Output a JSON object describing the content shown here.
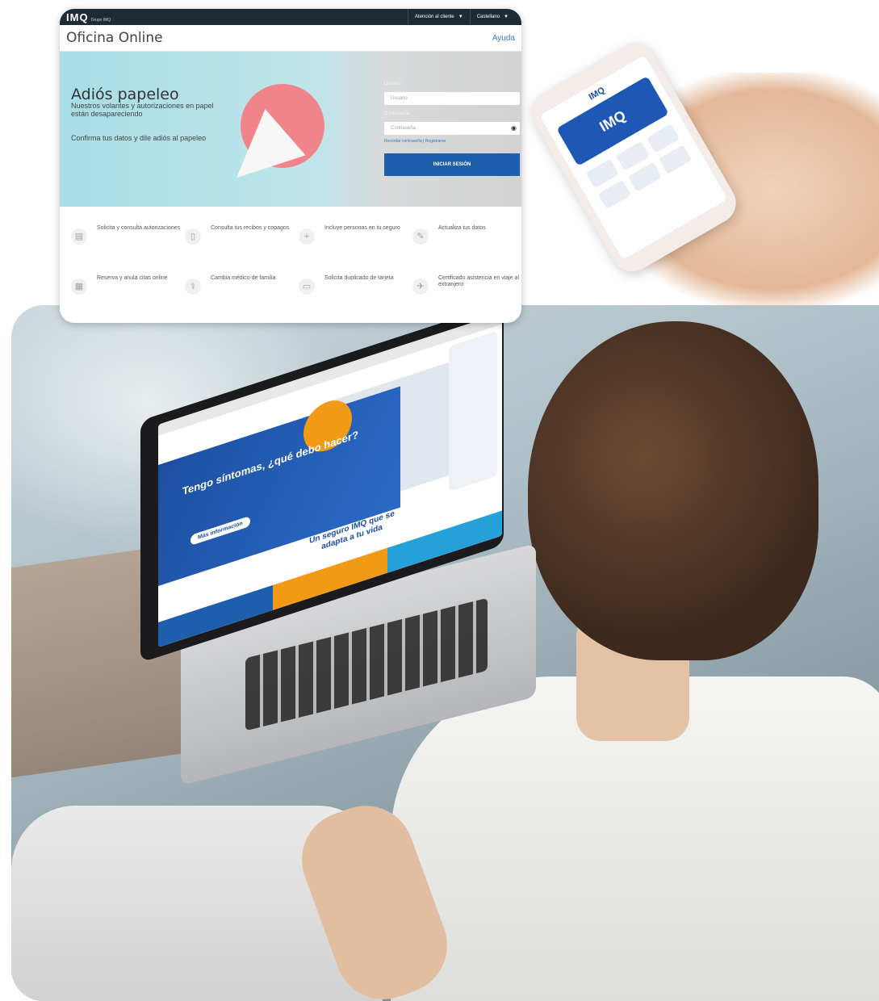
{
  "portal": {
    "logo": "IMQ",
    "logo_sub": "Grupo IMQ",
    "attention_label": "Atención al cliente",
    "language_label": "Castellano",
    "page_title": "Oficina Online",
    "help_label": "Ayuda",
    "banner": {
      "heading": "Adiós papeleo",
      "line1": "Nuestros volantes y autorizaciones en papel están desapareciendo",
      "line2": "Confirma tus datos y dile adiós al papeleo"
    },
    "login": {
      "user_label": "Usuario",
      "user_placeholder": "Usuario",
      "password_label": "Contraseña",
      "password_placeholder": "Contraseña",
      "links": "Recordar contraseña | Registrarse",
      "submit_label": "INICIAR SESIÓN"
    },
    "services": [
      {
        "label": "Solicita y consulta autorizaciones",
        "icon": "document-icon"
      },
      {
        "label": "Consulta tus recibos y copagos",
        "icon": "receipt-icon"
      },
      {
        "label": "Incluye personas en tu seguro",
        "icon": "person-add-icon"
      },
      {
        "label": "Actualiza tus datos",
        "icon": "user-edit-icon"
      },
      {
        "label": "Reserva y anula citas online",
        "icon": "calendar-icon"
      },
      {
        "label": "Cambia médico de familia",
        "icon": "doctor-icon"
      },
      {
        "label": "Solicita duplicado de tarjeta",
        "icon": "card-icon"
      },
      {
        "label": "Certificado asistencia en viaje al extranjero",
        "icon": "plane-icon"
      }
    ]
  },
  "phone": {
    "app_logo": "IMQ",
    "card_text": "IMQ"
  },
  "laptop": {
    "hero_title": "Tengo síntomas, ¿qué debo hacer?",
    "hero_button": "Más información",
    "tagline": "Un seguro IMQ que se adapta a tu vida",
    "stripe_colors": [
      "#1d5fad",
      "#f29a16",
      "#26a0d8"
    ]
  },
  "colors": {
    "topbar": "#1d2b36",
    "accent": "#1d5fad",
    "link": "#2f79c4",
    "banner": "#a8dde6",
    "circle": "#f1848b"
  }
}
